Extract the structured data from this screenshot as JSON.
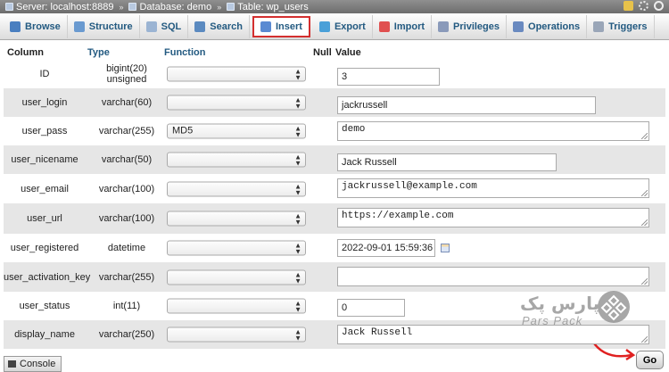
{
  "breadcrumb": {
    "server": "Server: localhost:8889",
    "database": "Database: demo",
    "table": "Table: wp_users"
  },
  "tabs": [
    {
      "label": "Browse",
      "icon": "browse-icon",
      "color": "#4a7fc0"
    },
    {
      "label": "Structure",
      "icon": "structure-icon",
      "color": "#6a9ad0"
    },
    {
      "label": "SQL",
      "icon": "sql-icon",
      "color": "#9bb4d3"
    },
    {
      "label": "Search",
      "icon": "search-icon",
      "color": "#5b8ac0"
    },
    {
      "label": "Insert",
      "icon": "insert-icon",
      "color": "#5a8ad2",
      "active": true
    },
    {
      "label": "Export",
      "icon": "export-icon",
      "color": "#4aa0d8"
    },
    {
      "label": "Import",
      "icon": "import-icon",
      "color": "#e05050"
    },
    {
      "label": "Privileges",
      "icon": "privileges-icon",
      "color": "#8a9aba"
    },
    {
      "label": "Operations",
      "icon": "operations-icon",
      "color": "#6a8ac0"
    },
    {
      "label": "Triggers",
      "icon": "triggers-icon",
      "color": "#9aa6b8"
    }
  ],
  "table_headers": {
    "column": "Column",
    "type": "Type",
    "function": "Function",
    "null": "Null",
    "value": "Value"
  },
  "rows": [
    {
      "column": "ID",
      "type": "bigint(20) unsigned",
      "function": "",
      "value": "3",
      "input": "text"
    },
    {
      "column": "user_login",
      "type": "varchar(60)",
      "function": "",
      "value": "jackrussell",
      "input": "text"
    },
    {
      "column": "user_pass",
      "type": "varchar(255)",
      "function": "MD5",
      "value": "demo",
      "input": "textarea"
    },
    {
      "column": "user_nicename",
      "type": "varchar(50)",
      "function": "",
      "value": "Jack Russell",
      "input": "text"
    },
    {
      "column": "user_email",
      "type": "varchar(100)",
      "function": "",
      "value": "jackrussell@example.com",
      "input": "textarea"
    },
    {
      "column": "user_url",
      "type": "varchar(100)",
      "function": "",
      "value": "https://example.com",
      "input": "textarea"
    },
    {
      "column": "user_registered",
      "type": "datetime",
      "function": "",
      "value": "2022-09-01 15:59:36",
      "input": "datetime"
    },
    {
      "column": "user_activation_key",
      "type": "varchar(255)",
      "function": "",
      "value": "",
      "input": "textarea"
    },
    {
      "column": "user_status",
      "type": "int(11)",
      "function": "",
      "value": "0",
      "input": "text"
    },
    {
      "column": "display_name",
      "type": "varchar(250)",
      "function": "",
      "value": "Jack Russell",
      "input": "textarea"
    }
  ],
  "console_label": "Console",
  "go_label": "Go",
  "watermark": {
    "fa": "پارس پک",
    "en": "Pars Pack"
  },
  "colors": {
    "header_link": "#235a81",
    "active_tab_border": "#d32f2f",
    "arrow": "#e02020"
  }
}
